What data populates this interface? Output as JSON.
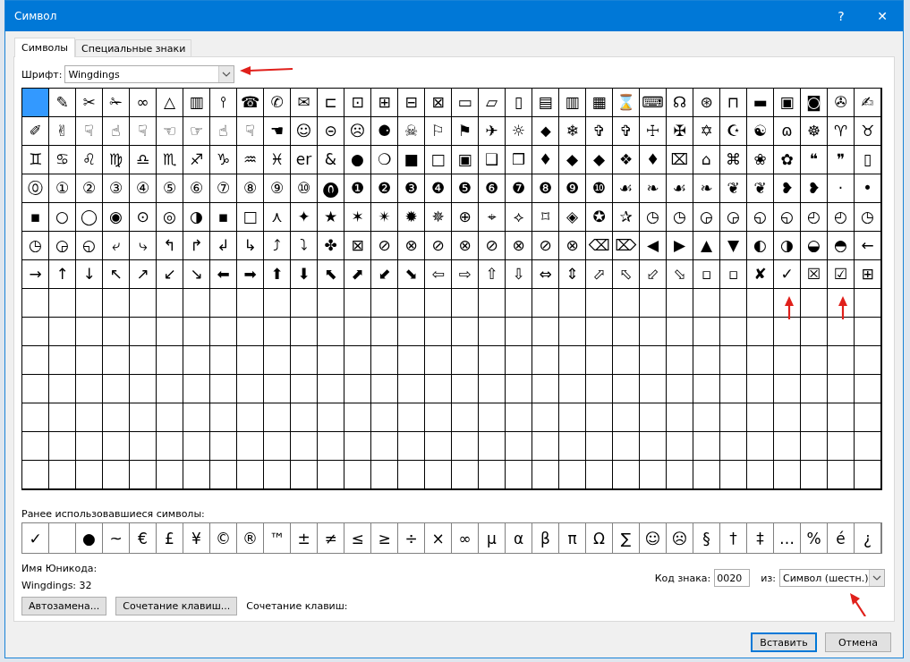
{
  "window": {
    "title": "Символ",
    "help": "?",
    "close": "✕"
  },
  "tabs": [
    {
      "label": "Символы",
      "selected": true
    },
    {
      "label": "Специальные знаки",
      "selected": false
    }
  ],
  "font": {
    "label": "Шрифт:",
    "value": "Wingdings"
  },
  "symbol_grid": {
    "rows": [
      [
        {
          "selected": true
        },
        {
          "symbol": "✎",
          "selected": false
        },
        {
          "symbol": "✂",
          "selected": false
        },
        {
          "symbol": "✁",
          "selected": false
        },
        {
          "symbol": "∞",
          "selected": false
        },
        {
          "symbol": "△",
          "selected": false
        },
        {
          "symbol": "▥",
          "selected": false
        },
        {
          "symbol": "⫯",
          "selected": false
        },
        {
          "symbol": "☎",
          "selected": false
        },
        {
          "symbol": "✆",
          "selected": false
        },
        {
          "symbol": "✉",
          "selected": false
        },
        {
          "symbol": "⊏",
          "selected": false
        },
        {
          "symbol": "⊡",
          "selected": false
        },
        {
          "symbol": "⊞",
          "selected": false
        },
        {
          "symbol": "⊟",
          "selected": false
        },
        {
          "symbol": "⊠",
          "selected": false
        },
        {
          "symbol": "▭",
          "selected": false
        },
        {
          "symbol": "▱",
          "selected": false
        },
        {
          "symbol": "▯",
          "selected": false
        },
        {
          "symbol": "▤",
          "selected": false
        },
        {
          "symbol": "▥",
          "selected": false
        },
        {
          "symbol": "▦",
          "selected": false
        },
        {
          "symbol": "⌛",
          "selected": false
        },
        {
          "symbol": "⌨",
          "selected": false
        },
        {
          "symbol": "☊",
          "selected": false
        },
        {
          "symbol": "⊛",
          "selected": false
        },
        {
          "symbol": "⊓",
          "selected": false
        },
        {
          "symbol": "▬",
          "selected": false
        },
        {
          "symbol": "▣",
          "selected": false
        },
        {
          "symbol": "◙",
          "selected": false
        },
        {
          "symbol": "✇",
          "selected": false
        },
        {
          "symbol": "✍",
          "selected": false
        }
      ],
      [
        {
          "symbol": "✐",
          "selected": false
        },
        {
          "symbol": "✌",
          "selected": false
        },
        {
          "symbol": "☟",
          "selected": false
        },
        {
          "symbol": "☝",
          "selected": false
        },
        {
          "symbol": "☟",
          "selected": false
        },
        {
          "symbol": "☜",
          "selected": false
        },
        {
          "symbol": "☞",
          "selected": false
        },
        {
          "symbol": "☝",
          "selected": false
        },
        {
          "symbol": "☟",
          "selected": false
        },
        {
          "symbol": "☚",
          "selected": false
        },
        {
          "symbol": "☺",
          "selected": false
        },
        {
          "symbol": "⊝",
          "selected": false
        },
        {
          "symbol": "☹",
          "selected": false
        },
        {
          "symbol": "⚈",
          "selected": false
        },
        {
          "symbol": "☠",
          "selected": false
        },
        {
          "symbol": "⚐",
          "selected": false
        },
        {
          "symbol": "⚑",
          "selected": false
        },
        {
          "symbol": "✈",
          "selected": false
        },
        {
          "symbol": "☼",
          "selected": false
        },
        {
          "symbol": "⬥",
          "selected": false
        },
        {
          "symbol": "❄",
          "selected": false
        },
        {
          "symbol": "✞",
          "selected": false
        },
        {
          "symbol": "✞",
          "selected": false
        },
        {
          "symbol": "☩",
          "selected": false
        },
        {
          "symbol": "✠",
          "selected": false
        },
        {
          "symbol": "✡",
          "selected": false
        },
        {
          "symbol": "☪",
          "selected": false
        },
        {
          "symbol": "☯",
          "selected": false
        },
        {
          "symbol": "ɷ",
          "selected": false
        },
        {
          "symbol": "☸",
          "selected": false
        },
        {
          "symbol": "♈",
          "selected": false
        },
        {
          "symbol": "♉",
          "selected": false
        }
      ],
      [
        {
          "symbol": "♊",
          "selected": false
        },
        {
          "symbol": "♋",
          "selected": false
        },
        {
          "symbol": "♌",
          "selected": false
        },
        {
          "symbol": "♍",
          "selected": false
        },
        {
          "symbol": "♎",
          "selected": false
        },
        {
          "symbol": "♏",
          "selected": false
        },
        {
          "symbol": "♐",
          "selected": false
        },
        {
          "symbol": "♑",
          "selected": false
        },
        {
          "symbol": "♒",
          "selected": false
        },
        {
          "symbol": "♓",
          "selected": false
        },
        {
          "symbol": "er",
          "selected": false
        },
        {
          "symbol": "&",
          "selected": false
        },
        {
          "symbol": "●",
          "selected": false
        },
        {
          "symbol": "❍",
          "selected": false
        },
        {
          "symbol": "■",
          "selected": false
        },
        {
          "symbol": "□",
          "selected": false
        },
        {
          "symbol": "▣",
          "selected": false
        },
        {
          "symbol": "❑",
          "selected": false
        },
        {
          "symbol": "❒",
          "selected": false
        },
        {
          "symbol": "♦",
          "selected": false
        },
        {
          "symbol": "◆",
          "selected": false
        },
        {
          "symbol": "◆",
          "selected": false
        },
        {
          "symbol": "❖",
          "selected": false
        },
        {
          "symbol": "♦",
          "selected": false
        },
        {
          "symbol": "⌧",
          "selected": false
        },
        {
          "symbol": "⌂",
          "selected": false
        },
        {
          "symbol": "⌘",
          "selected": false
        },
        {
          "symbol": "❀",
          "selected": false
        },
        {
          "symbol": "✿",
          "selected": false
        },
        {
          "symbol": "❝",
          "selected": false
        },
        {
          "symbol": "❞",
          "selected": false
        },
        {
          "symbol": "▯",
          "selected": false
        }
      ],
      [
        {
          "symbol": "⓪",
          "selected": false
        },
        {
          "symbol": "①",
          "selected": false
        },
        {
          "symbol": "②",
          "selected": false
        },
        {
          "symbol": "③",
          "selected": false
        },
        {
          "symbol": "④",
          "selected": false
        },
        {
          "symbol": "⑤",
          "selected": false
        },
        {
          "symbol": "⑥",
          "selected": false
        },
        {
          "symbol": "⑦",
          "selected": false
        },
        {
          "symbol": "⑧",
          "selected": false
        },
        {
          "symbol": "⑨",
          "selected": false
        },
        {
          "symbol": "⑩",
          "selected": false
        },
        {
          "symbol": "⓿",
          "selected": false
        },
        {
          "symbol": "❶",
          "selected": false
        },
        {
          "symbol": "❷",
          "selected": false
        },
        {
          "symbol": "❸",
          "selected": false
        },
        {
          "symbol": "❹",
          "selected": false
        },
        {
          "symbol": "❺",
          "selected": false
        },
        {
          "symbol": "❻",
          "selected": false
        },
        {
          "symbol": "❼",
          "selected": false
        },
        {
          "symbol": "❽",
          "selected": false
        },
        {
          "symbol": "❾",
          "selected": false
        },
        {
          "symbol": "❿",
          "selected": false
        },
        {
          "symbol": "☙",
          "selected": false
        },
        {
          "symbol": "❧",
          "selected": false
        },
        {
          "symbol": "☙",
          "selected": false
        },
        {
          "symbol": "❧",
          "selected": false
        },
        {
          "symbol": "❦",
          "selected": false
        },
        {
          "symbol": "❦",
          "selected": false
        },
        {
          "symbol": "❥",
          "selected": false
        },
        {
          "symbol": "❥",
          "selected": false
        },
        {
          "symbol": "·",
          "selected": false
        },
        {
          "symbol": "•",
          "selected": false
        }
      ],
      [
        {
          "symbol": "▪",
          "selected": false
        },
        {
          "symbol": "○",
          "selected": false
        },
        {
          "symbol": "◯",
          "selected": false
        },
        {
          "symbol": "◉",
          "selected": false
        },
        {
          "symbol": "⊙",
          "selected": false
        },
        {
          "symbol": "◎",
          "selected": false
        },
        {
          "symbol": "◑",
          "selected": false
        },
        {
          "symbol": "▪",
          "selected": false
        },
        {
          "symbol": "□",
          "selected": false
        },
        {
          "symbol": "⋏",
          "selected": false
        },
        {
          "symbol": "✦",
          "selected": false
        },
        {
          "symbol": "★",
          "selected": false
        },
        {
          "symbol": "✶",
          "selected": false
        },
        {
          "symbol": "✴",
          "selected": false
        },
        {
          "symbol": "✹",
          "selected": false
        },
        {
          "symbol": "✵",
          "selected": false
        },
        {
          "symbol": "⊕",
          "selected": false
        },
        {
          "symbol": "⌖",
          "selected": false
        },
        {
          "symbol": "⟡",
          "selected": false
        },
        {
          "symbol": "⌑",
          "selected": false
        },
        {
          "symbol": "◈",
          "selected": false
        },
        {
          "symbol": "✪",
          "selected": false
        },
        {
          "symbol": "✰",
          "selected": false
        },
        {
          "symbol": "◷",
          "selected": false
        },
        {
          "symbol": "◷",
          "selected": false
        },
        {
          "symbol": "◶",
          "selected": false
        },
        {
          "symbol": "◶",
          "selected": false
        },
        {
          "symbol": "◵",
          "selected": false
        },
        {
          "symbol": "◵",
          "selected": false
        },
        {
          "symbol": "◴",
          "selected": false
        },
        {
          "symbol": "◴",
          "selected": false
        },
        {
          "symbol": "◷",
          "selected": false
        }
      ],
      [
        {
          "symbol": "◷",
          "selected": false
        },
        {
          "symbol": "◶",
          "selected": false
        },
        {
          "symbol": "◵",
          "selected": false
        },
        {
          "symbol": "⤶",
          "selected": false
        },
        {
          "symbol": "⤷",
          "selected": false
        },
        {
          "symbol": "↰",
          "selected": false
        },
        {
          "symbol": "↱",
          "selected": false
        },
        {
          "symbol": "↲",
          "selected": false
        },
        {
          "symbol": "↳",
          "selected": false
        },
        {
          "symbol": "⤴",
          "selected": false
        },
        {
          "symbol": "⤵",
          "selected": false
        },
        {
          "symbol": "✤",
          "selected": false
        },
        {
          "symbol": "⊠",
          "selected": false
        },
        {
          "symbol": "⊘",
          "selected": false
        },
        {
          "symbol": "⊗",
          "selected": false
        },
        {
          "symbol": "⊘",
          "selected": false
        },
        {
          "symbol": "⊗",
          "selected": false
        },
        {
          "symbol": "⊘",
          "selected": false
        },
        {
          "symbol": "⊗",
          "selected": false
        },
        {
          "symbol": "⊘",
          "selected": false
        },
        {
          "symbol": "⊗",
          "selected": false
        },
        {
          "symbol": "⌫",
          "selected": false
        },
        {
          "symbol": "⌦",
          "selected": false
        },
        {
          "symbol": "◀",
          "selected": false
        },
        {
          "symbol": "▶",
          "selected": false
        },
        {
          "symbol": "▲",
          "selected": false
        },
        {
          "symbol": "▼",
          "selected": false
        },
        {
          "symbol": "◐",
          "selected": false
        },
        {
          "symbol": "◑",
          "selected": false
        },
        {
          "symbol": "◒",
          "selected": false
        },
        {
          "symbol": "◓",
          "selected": false
        },
        {
          "symbol": "←",
          "selected": false
        }
      ],
      [
        {
          "symbol": "→",
          "selected": false
        },
        {
          "symbol": "↑",
          "selected": false
        },
        {
          "symbol": "↓",
          "selected": false
        },
        {
          "symbol": "↖",
          "selected": false
        },
        {
          "symbol": "↗",
          "selected": false
        },
        {
          "symbol": "↙",
          "selected": false
        },
        {
          "symbol": "↘",
          "selected": false
        },
        {
          "symbol": "⬅",
          "selected": false
        },
        {
          "symbol": "➡",
          "selected": false
        },
        {
          "symbol": "⬆",
          "selected": false
        },
        {
          "symbol": "⬇",
          "selected": false
        },
        {
          "symbol": "⬉",
          "selected": false
        },
        {
          "symbol": "⬈",
          "selected": false
        },
        {
          "symbol": "⬋",
          "selected": false
        },
        {
          "symbol": "⬊",
          "selected": false
        },
        {
          "symbol": "⇦",
          "selected": false
        },
        {
          "symbol": "⇨",
          "selected": false
        },
        {
          "symbol": "⇧",
          "selected": false
        },
        {
          "symbol": "⇩",
          "selected": false
        },
        {
          "symbol": "⇔",
          "selected": false
        },
        {
          "symbol": "⇕",
          "selected": false
        },
        {
          "symbol": "⬀",
          "selected": false
        },
        {
          "symbol": "⬁",
          "selected": false
        },
        {
          "symbol": "⬃",
          "selected": false
        },
        {
          "symbol": "⬂",
          "selected": false
        },
        {
          "symbol": "▫",
          "selected": false
        },
        {
          "symbol": "▫",
          "selected": false
        },
        {
          "symbol": "✘",
          "selected": false
        },
        {
          "symbol": "✓",
          "selected": false
        },
        {
          "symbol": "☒",
          "selected": false
        },
        {
          "symbol": "☑",
          "selected": false
        },
        {
          "symbol": "⊞",
          "selected": false
        }
      ]
    ]
  },
  "recent": {
    "label": "Ранее использовавшиеся символы:",
    "symbols": [
      {
        "kind": "symbol",
        "symbol": "✓"
      },
      {
        "kind": "blank"
      },
      {
        "kind": "symbol",
        "symbol": "●"
      },
      {
        "kind": "symbol",
        "symbol": "~"
      },
      {
        "kind": "symbol",
        "symbol": "€"
      },
      {
        "kind": "symbol",
        "symbol": "£"
      },
      {
        "kind": "symbol",
        "symbol": "¥"
      },
      {
        "kind": "symbol",
        "symbol": "©"
      },
      {
        "kind": "symbol",
        "symbol": "®"
      },
      {
        "kind": "symbol",
        "symbol": "™"
      },
      {
        "kind": "symbol",
        "symbol": "±"
      },
      {
        "kind": "symbol",
        "symbol": "≠"
      },
      {
        "kind": "symbol",
        "symbol": "≤"
      },
      {
        "kind": "symbol",
        "symbol": "≥"
      },
      {
        "kind": "symbol",
        "symbol": "÷"
      },
      {
        "kind": "symbol",
        "symbol": "×"
      },
      {
        "kind": "symbol",
        "symbol": "∞"
      },
      {
        "kind": "symbol",
        "symbol": "µ"
      },
      {
        "kind": "symbol",
        "symbol": "α"
      },
      {
        "kind": "symbol",
        "symbol": "β"
      },
      {
        "kind": "symbol",
        "symbol": "π"
      },
      {
        "kind": "symbol",
        "symbol": "Ω"
      },
      {
        "kind": "symbol",
        "symbol": "∑"
      },
      {
        "kind": "symbol",
        "symbol": "☺"
      },
      {
        "kind": "symbol",
        "symbol": "☹"
      },
      {
        "kind": "symbol",
        "symbol": "§"
      },
      {
        "kind": "symbol",
        "symbol": "†"
      },
      {
        "kind": "symbol",
        "symbol": "‡"
      },
      {
        "kind": "symbol",
        "symbol": "…"
      },
      {
        "kind": "symbol",
        "symbol": "%"
      },
      {
        "kind": "symbol",
        "symbol": "é"
      },
      {
        "kind": "symbol",
        "symbol": "¿"
      }
    ]
  },
  "unicode_name": {
    "label": "Имя Юникода:",
    "value": "Wingdings: 32"
  },
  "buttons_left": [
    "Автозамена...",
    "Сочетание клавиш..."
  ],
  "shortcut_label": "Сочетание клавиш:",
  "char_code": {
    "label": "Код знака:",
    "value": "0020"
  },
  "from": {
    "label": "из:",
    "value": "Символ (шестн.)"
  },
  "dialog_buttons": [
    {
      "label": "Вставить",
      "default": true
    },
    {
      "label": "Отмена",
      "default": false
    }
  ],
  "annotation_arrows": [
    {
      "kind": "left"
    },
    {
      "kind": "up"
    },
    {
      "kind": "up"
    },
    {
      "kind": "up-left"
    }
  ]
}
